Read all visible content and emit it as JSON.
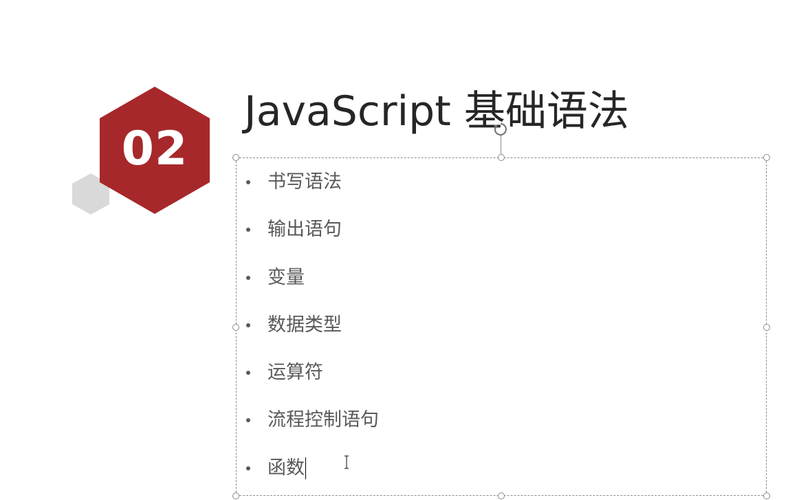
{
  "section": {
    "number": "02",
    "accent_color": "#a7282a",
    "secondary_shape_color": "#d9d9d9"
  },
  "slide": {
    "title": "JavaScript 基础语法",
    "bullets": [
      "书写语法",
      "输出语句",
      "变量",
      "数据类型",
      "运算符",
      "流程控制语句",
      "函数"
    ]
  },
  "icons": {
    "rotate_handle": "rotate-handle-icon",
    "cursor": "text-cursor-icon"
  }
}
